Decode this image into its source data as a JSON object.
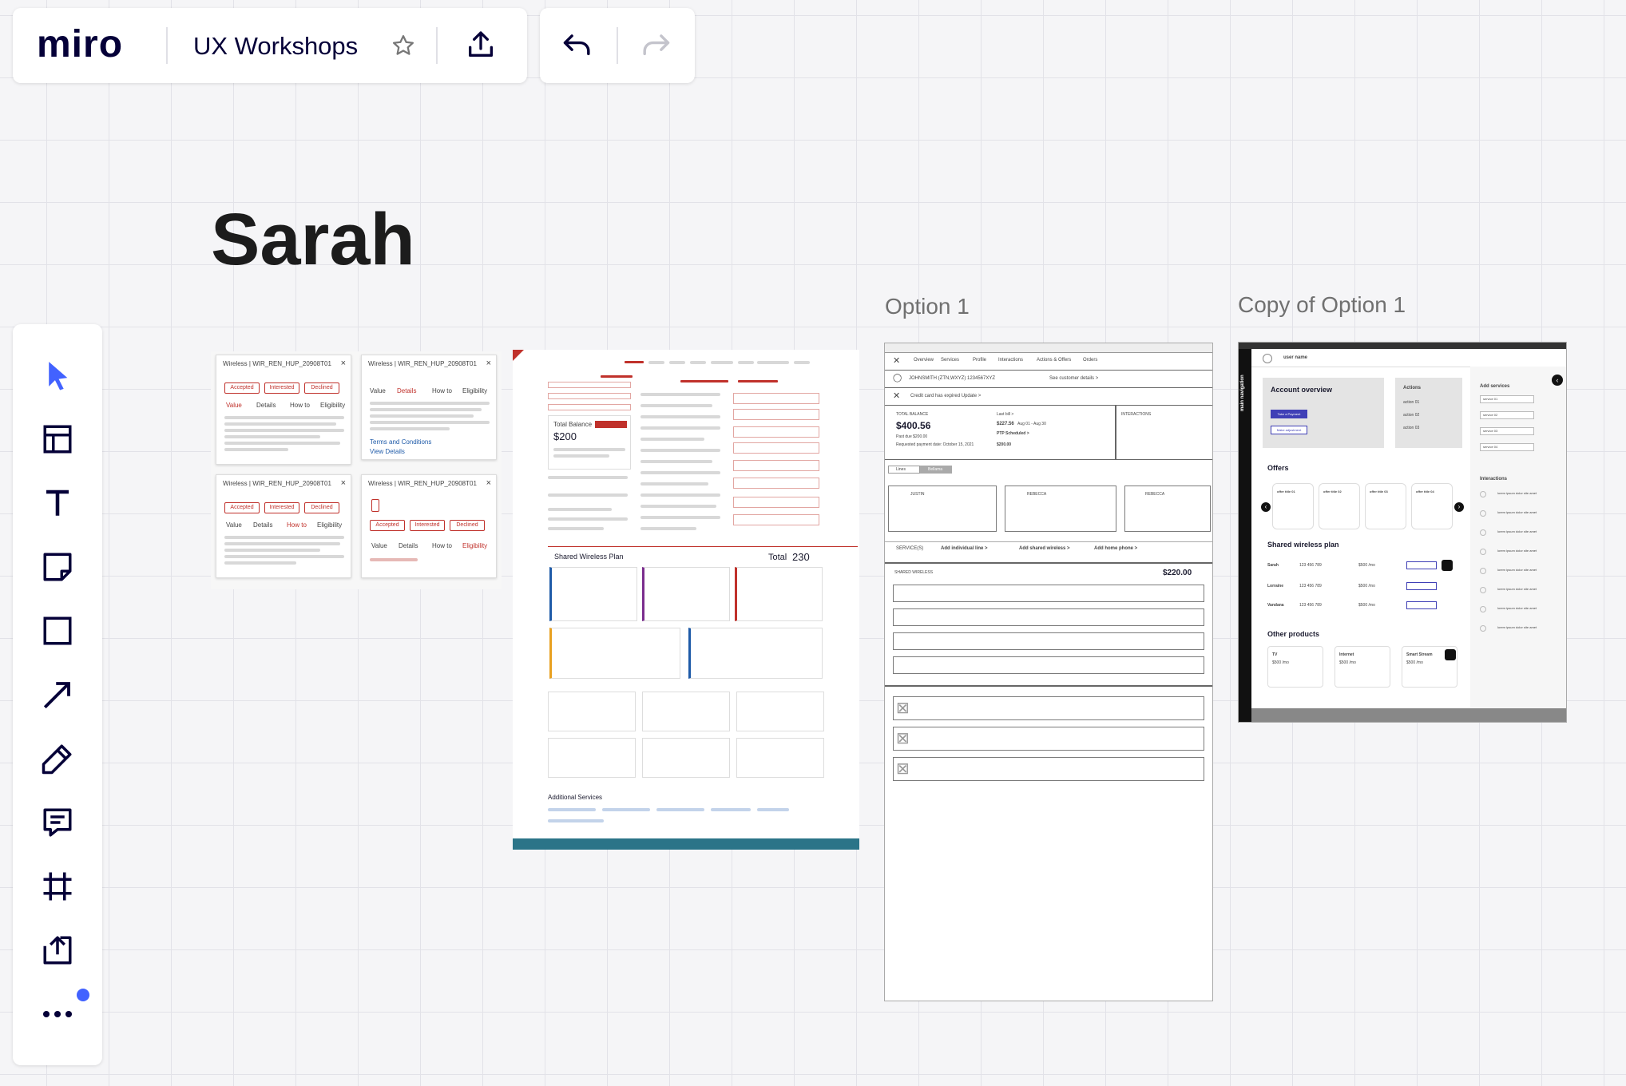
{
  "app": {
    "logo": "miro",
    "board_title": "UX Workshops"
  },
  "icons": {
    "star": "star-icon",
    "export": "export-icon",
    "undo": "undo-icon",
    "redo": "redo-icon"
  },
  "toolbar": {
    "tools": [
      "select-icon",
      "template-icon",
      "text-icon",
      "sticky-note-icon",
      "shape-icon",
      "arrow-icon",
      "pen-icon",
      "comment-icon",
      "frame-icon",
      "upload-icon",
      "more-icon"
    ],
    "accent": "#4262ff"
  },
  "board": {
    "heading": "Sarah",
    "frames": [
      {
        "title": "Option 1"
      },
      {
        "title": "Copy of Option 1"
      }
    ]
  },
  "popups": {
    "title": "Wireless | WIR_REN_HUP_20908T01",
    "title2": "Wireless | WIR_REN_HUP_20908T01",
    "title3": "Wireless | WIR_REN_HUP_20908T01",
    "title4": "Wireless | WIR_REN_HUP_20908T01",
    "btn_accepted": "Accepted",
    "btn_interested": "Interested",
    "btn_declined": "Declined",
    "tab_value": "Value",
    "tab_details": "Details",
    "tab_howto": "How to",
    "tab_eligibility": "Eligibility",
    "terms": "Terms and Conditions",
    "view_details": "View Details"
  },
  "dashboard": {
    "total_balance_label": "Total Balance",
    "total_balance": "$200",
    "shared_plan": "Shared Wireless Plan",
    "total_label": "Total",
    "total_value": "230",
    "additional_services": "Additional Services"
  },
  "option1": {
    "nav": [
      "Overview",
      "Services",
      "Profile",
      "Interactions",
      "Actions & Offers",
      "Orders"
    ],
    "account_line": "JOHNSMITH (ZTN,WXYZ)    1234567XYZ",
    "see_customer": "See customer details >",
    "credit_line": "Credit card has expired   Update >",
    "total_balance_label": "TOTAL BALANCE",
    "total_balance": "$400.56",
    "last_bill": "Last bill >",
    "bill_amount": "$227.56",
    "bill_period": "Aug 01 - Aug 30",
    "ptp": "PTP Scheduled >",
    "ptp_amount": "$200.00",
    "past_due": "Past due $200.00",
    "payment_date": "Requested payment date: October 15, 2021",
    "interactions": "INTERACTIONS",
    "tab_a": "Lines",
    "tab_b": "Bellama",
    "cards": [
      "JUSTIN",
      "REBECCA",
      "REBECCA"
    ],
    "services": "SERVICE(S)",
    "add_line": "Add individual line >",
    "add_shared": "Add shared wireless >",
    "add_home": "Add home phone >",
    "shared_label": "SHARED WIRELESS",
    "shared_amount": "$220.00"
  },
  "copy": {
    "user": "user name",
    "side": "main navigation",
    "overview": "Account overview",
    "btn1": "Take a Payment",
    "btn2": "Make adjustment",
    "actions": "Actions",
    "actions_items": [
      "action 01",
      "action 02",
      "action 03"
    ],
    "add_services": "Add services",
    "services_items": [
      "service 01",
      "service 02",
      "service 03",
      "service 04"
    ],
    "offers": "Offers",
    "offer_titles": [
      "offer title 01",
      "offer title 02",
      "offer title 03",
      "offer title 04"
    ],
    "interactions": "Interactions",
    "shared": "Shared wireless plan",
    "rows": [
      {
        "name": "Sarah",
        "num": "123 456 789",
        "price": "$500 /mo"
      },
      {
        "name": "Lorraine",
        "num": "123 456 789",
        "price": "$500 /mo"
      },
      {
        "name": "Vandana",
        "num": "123 456 789",
        "price": "$500 /mo"
      }
    ],
    "other": "Other products",
    "products": [
      {
        "name": "TV",
        "price": "$500 /mo"
      },
      {
        "name": "Internet",
        "price": "$500 /mo"
      },
      {
        "name": "Smart Stream",
        "price": "$500 /mo"
      }
    ],
    "lorem": "lorem ipsum dolor site amet"
  }
}
